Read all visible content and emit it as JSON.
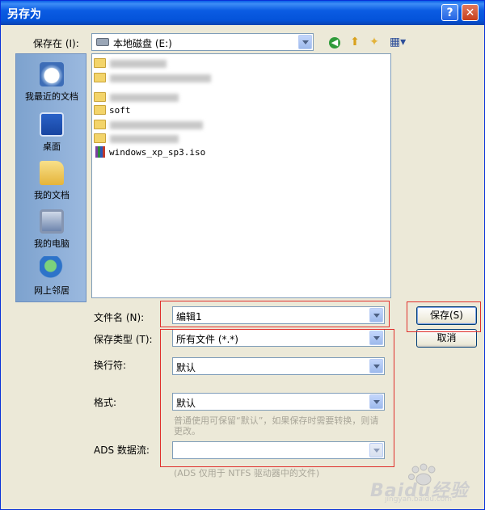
{
  "window": {
    "title": "另存为",
    "help_glyph": "?",
    "close_glyph": "✕"
  },
  "toolbar": {
    "save_in_label": "保存在 (I):",
    "location": "本地磁盘 (E:)"
  },
  "places": [
    {
      "label": "我最近的文档",
      "icon": "recent-documents-icon"
    },
    {
      "label": "桌面",
      "icon": "desktop-icon"
    },
    {
      "label": "我的文档",
      "icon": "my-documents-icon"
    },
    {
      "label": "我的电脑",
      "icon": "my-computer-icon"
    },
    {
      "label": "网上邻居",
      "icon": "network-places-icon"
    }
  ],
  "files": [
    {
      "type": "folder",
      "name": ""
    },
    {
      "type": "folder",
      "name": ""
    },
    {
      "type": "folder",
      "name": ""
    },
    {
      "type": "folder",
      "name": "soft"
    },
    {
      "type": "folder",
      "name": ""
    },
    {
      "type": "folder",
      "name": ""
    },
    {
      "type": "iso",
      "name": "windows_xp_sp3.iso"
    }
  ],
  "form": {
    "filename_label": "文件名 (N):",
    "filename_value": "编辑1",
    "filetype_label": "保存类型 (T):",
    "filetype_value": "所有文件 (*.*)",
    "linebreak_label": "换行符:",
    "linebreak_value": "默认",
    "format_label": "格式:",
    "format_value": "默认",
    "format_hint": "普通使用可保留“默认”，如果保存时需要转换，则请更改。",
    "ads_label": "ADS 数据流:",
    "ads_value": "",
    "ads_hint": "(ADS 仅用于 NTFS 驱动器中的文件)"
  },
  "buttons": {
    "save": "保存(S)",
    "cancel": "取消"
  },
  "watermark": {
    "text": "Baidu经验",
    "sub": "jingyan.baidu.com"
  },
  "colors": {
    "titlebar": "#0a5ee8",
    "dialog_bg": "#ece9d8",
    "highlight_box": "#e0302c"
  }
}
